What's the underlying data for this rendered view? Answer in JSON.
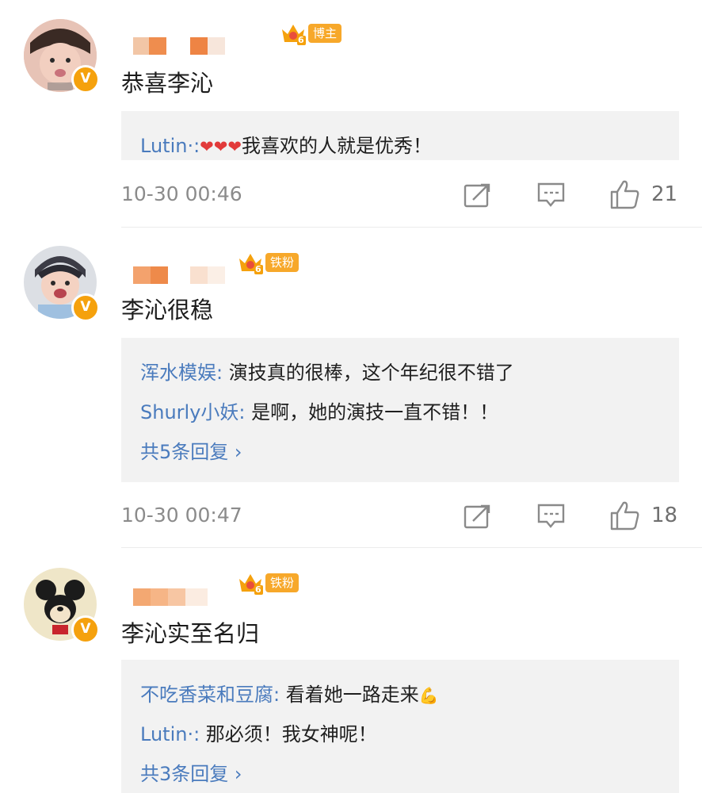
{
  "comments": [
    {
      "badge": "博主",
      "vip_level": "6",
      "text": "恭喜李沁",
      "replies": [
        {
          "user": "Lutin·:",
          "hearts": "❤❤❤",
          "text": "我喜欢的人就是优秀！"
        }
      ],
      "more": "",
      "time": "10-30 00:46",
      "likes": "21"
    },
    {
      "badge": "铁粉",
      "vip_level": "6",
      "text": "李沁很稳",
      "replies": [
        {
          "user": "浑水模娱:",
          "text": " 演技真的很棒，这个年纪很不错了"
        },
        {
          "user": "Shurly小妖:",
          "text": " 是啊，她的演技一直不错！！"
        }
      ],
      "more": "共5条回复 ›",
      "time": "10-30 00:47",
      "likes": "18"
    },
    {
      "badge": "铁粉",
      "vip_level": "6",
      "text": "李沁实至名归",
      "replies": [
        {
          "user": "不吃香菜和豆腐:",
          "text": " 看着她一路走来",
          "emoji": "💪"
        },
        {
          "user": "Lutin·:",
          "text": " 那必须！我女神呢！"
        }
      ],
      "more": "共3条回复 ›"
    }
  ],
  "colors": {
    "link": "#4a7bbd",
    "badge_orange": "#f7a82a",
    "reply_bg": "#f2f2f2"
  },
  "icons": [
    "share-icon",
    "comment-icon",
    "like-icon",
    "verified-v-icon",
    "crown-level-icon"
  ]
}
